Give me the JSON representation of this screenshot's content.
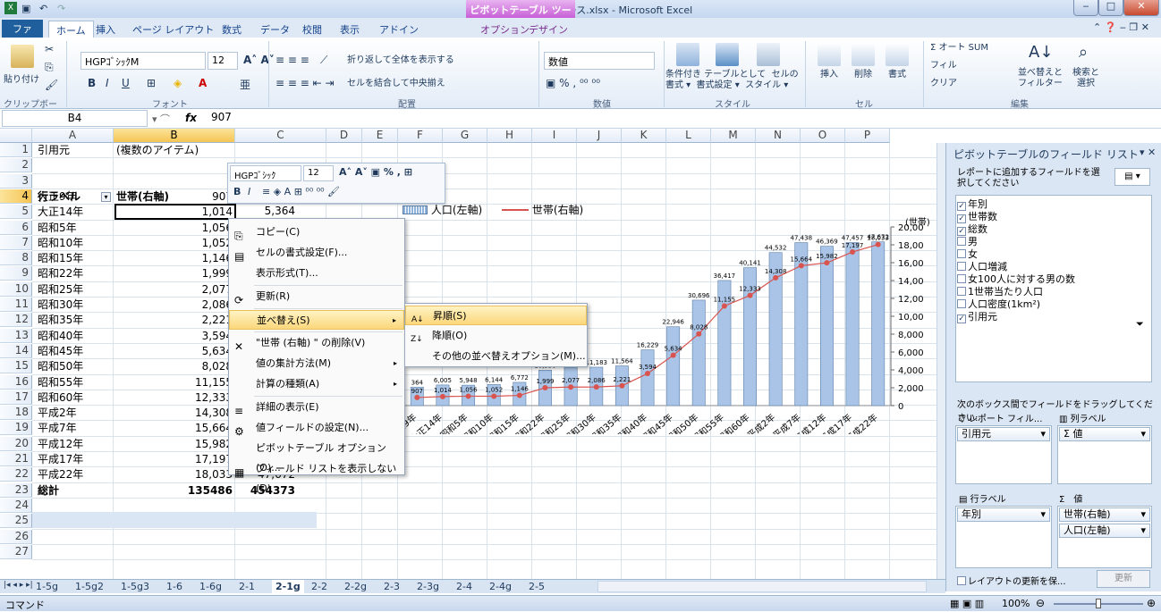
{
  "app": {
    "title": "統計さむかわデータベース.xlsx - Microsoft Excel",
    "context_tab_group": "ピボットテーブル ツール"
  },
  "ribbon_tabs": [
    "ファイル",
    "ホーム",
    "挿入",
    "ページ レイアウト",
    "数式",
    "データ",
    "校閲",
    "表示",
    "アドイン",
    "オプション",
    "デザイン"
  ],
  "ribbon": {
    "clipboard": {
      "paste": "貼り付け",
      "label": "クリップボード"
    },
    "font": {
      "name": "HGPｺﾞｼｯｸM",
      "size": "12",
      "label": "フォント"
    },
    "alignment": {
      "wrap": "折り返して全体を表示する",
      "merge": "セルを結合して中央揃え",
      "label": "配置"
    },
    "number": {
      "format": "数値",
      "label": "数値"
    },
    "styles": {
      "cond": "条件付き\n書式",
      "table": "テーブルとして\n書式設定",
      "cell": "セルの\nスタイル",
      "label": "スタイル"
    },
    "cells": {
      "insert": "挿入",
      "delete": "削除",
      "format": "書式",
      "label": "セル"
    },
    "edit": {
      "autosum": "Σ オート SUM",
      "fill": "フィル",
      "clear": "クリア",
      "sort": "並べ替えと\nフィルター",
      "find": "検索と\n選択",
      "label": "編集"
    }
  },
  "formula_bar": {
    "name_box": "B4",
    "fx": "fx",
    "value": "907"
  },
  "columns": [
    "A",
    "B",
    "C",
    "D",
    "E",
    "F",
    "G",
    "H",
    "I",
    "J",
    "K",
    "L",
    "M",
    "N",
    "O",
    "P"
  ],
  "rows": [
    "1",
    "2",
    "3",
    "4",
    "5",
    "6",
    "7",
    "8",
    "9",
    "10",
    "11",
    "12",
    "13",
    "14",
    "15",
    "16",
    "17",
    "18",
    "19",
    "20",
    "21",
    "22",
    "23",
    "24",
    "25",
    "26",
    "27"
  ],
  "pivot": {
    "r1_a": "引用元",
    "r1_b": "(複数のアイテム)",
    "r3_a": "行ラベル",
    "r3_b": "世帯(右軸)",
    "c4_partial": "5,364",
    "c19_partial": "46,369",
    "c20_partial": "46,369",
    "rows": [
      {
        "label": "大正9年",
        "households": "907",
        "pop": ""
      },
      {
        "label": "大正14年",
        "households": "1,014",
        "pop": ""
      },
      {
        "label": "昭和5年",
        "households": "1,056",
        "pop": ""
      },
      {
        "label": "昭和10年",
        "households": "1,052",
        "pop": ""
      },
      {
        "label": "昭和15年",
        "households": "1,146",
        "pop": ""
      },
      {
        "label": "昭和22年",
        "households": "1,999",
        "pop": ""
      },
      {
        "label": "昭和25年",
        "households": "2,077",
        "pop": ""
      },
      {
        "label": "昭和30年",
        "households": "2,086",
        "pop": ""
      },
      {
        "label": "昭和35年",
        "households": "2,221",
        "pop": ""
      },
      {
        "label": "昭和40年",
        "households": "3,594",
        "pop": ""
      },
      {
        "label": "昭和45年",
        "households": "5,634",
        "pop": ""
      },
      {
        "label": "昭和50年",
        "households": "8,028",
        "pop": ""
      },
      {
        "label": "昭和55年",
        "households": "11,155",
        "pop": ""
      },
      {
        "label": "昭和60年",
        "households": "12,333",
        "pop": ""
      },
      {
        "label": "平成2年",
        "households": "14,308",
        "pop": ""
      },
      {
        "label": "平成7年",
        "households": "15,664",
        "pop": ""
      },
      {
        "label": "平成12年",
        "households": "15,982",
        "pop": ""
      },
      {
        "label": "平成17年",
        "households": "17,197",
        "pop": "47,457"
      },
      {
        "label": "平成22年",
        "households": "18,033",
        "pop": "47,672"
      }
    ],
    "total": {
      "label": "総計",
      "households": "135486",
      "pop": "454373"
    }
  },
  "mini_toolbar": {
    "font": "HGPｺﾞｼｯｸ",
    "size": "12"
  },
  "context_menu": [
    {
      "label": "コピー(C)",
      "icon": "copy-icon"
    },
    {
      "label": "セルの書式設定(F)...",
      "icon": "format-cells-icon"
    },
    {
      "label": "表示形式(T)...",
      "icon": ""
    },
    {
      "label": "更新(R)",
      "icon": "refresh-icon"
    },
    {
      "label": "並べ替え(S)",
      "icon": "",
      "submenu": true,
      "highlighted": true
    },
    {
      "label": "\"世帯 (右軸) \" の削除(V)",
      "icon": "delete-x-icon"
    },
    {
      "label": "値の集計方法(M)",
      "icon": "",
      "submenu": true
    },
    {
      "label": "計算の種類(A)",
      "icon": "",
      "submenu": true
    },
    {
      "label": "詳細の表示(E)",
      "icon": "details-icon"
    },
    {
      "label": "値フィールドの設定(N)...",
      "icon": "field-settings-icon"
    },
    {
      "label": "ピボットテーブル オプション(O)...",
      "icon": ""
    },
    {
      "label": "フィールド リストを表示しない(D)",
      "icon": "field-list-icon"
    }
  ],
  "submenu": [
    {
      "label": "昇順(S)",
      "icon": "sort-asc-icon"
    },
    {
      "label": "降順(O)",
      "icon": "sort-desc-icon"
    },
    {
      "label": "その他の並べ替えオプション(M)...",
      "icon": ""
    }
  ],
  "chart_data": {
    "type": "bar",
    "categories": [
      "大正9年",
      "大正14年",
      "昭和5年",
      "昭和10年",
      "昭和15年",
      "昭和22年",
      "昭和25年",
      "昭和30年",
      "昭和35年",
      "昭和40年",
      "昭和45年",
      "昭和50年",
      "昭和55年",
      "昭和60年",
      "平成2年",
      "平成7年",
      "平成12年",
      "平成17年",
      "平成22年"
    ],
    "series": [
      {
        "name": "人口(左軸)",
        "kind": "bar",
        "values": [
          5364,
          6005,
          5948,
          6144,
          6772,
          10330,
          11166,
          11183,
          11564,
          16229,
          22946,
          30696,
          36417,
          40141,
          44532,
          47438,
          46369,
          47457,
          47672
        ],
        "color": "#8fb2dc"
      },
      {
        "name": "世帯(右軸)",
        "kind": "line",
        "values": [
          907,
          1014,
          1056,
          1052,
          1146,
          1999,
          2077,
          2086,
          2221,
          3594,
          5634,
          8028,
          11155,
          12333,
          14308,
          15664,
          15982,
          17197,
          18033
        ],
        "color": "#d9534f"
      }
    ],
    "bar_labels": [
      "364",
      "6,005",
      "5,948",
      "6,144",
      "6,772",
      "10,330",
      "11,166",
      "11,183",
      "11,564",
      "16,229",
      "22,946",
      "30,696",
      "36,417",
      "40,141",
      "44,532",
      "47,438",
      "46,369",
      "47,457",
      "47,672"
    ],
    "line_labels": [
      "907",
      "1,014",
      "1,056",
      "1,052",
      "1,146",
      "1,999",
      "2,077",
      "2,086",
      "2,221",
      "3,594",
      "5,634",
      "8,028",
      "11,155",
      "12,333",
      "14,308",
      "15,664",
      "15,982",
      "17,197",
      "18,033"
    ],
    "y_right_unit": "(世帯)",
    "y_right_ticks": [
      "0",
      "2,000",
      "4,000",
      "6,000",
      "8,000",
      "10,000",
      "12,000",
      "14,000",
      "16,000",
      "18,000",
      "20,000"
    ],
    "y2lim": [
      0,
      20000
    ],
    "legend": "top"
  },
  "field_list": {
    "title": "ピボットテーブルのフィールド リスト",
    "instruction": "レポートに追加するフィールドを選択してください",
    "fields": [
      {
        "label": "年別",
        "checked": true
      },
      {
        "label": "世帯数",
        "checked": true
      },
      {
        "label": "総数",
        "checked": true
      },
      {
        "label": "男",
        "checked": false
      },
      {
        "label": "女",
        "checked": false
      },
      {
        "label": "人口増減",
        "checked": false
      },
      {
        "label": "女100人に対する男の数",
        "checked": false
      },
      {
        "label": "1世帯当たり人口",
        "checked": false
      },
      {
        "label": "人口密度(1km²)",
        "checked": false
      },
      {
        "label": "引用元",
        "checked": true
      }
    ],
    "drag_hint": "次のボックス間でフィールドをドラッグしてください:",
    "report_filter": "レポート フィル...",
    "col_labels": "列ラベル",
    "filter_chip": "引用元",
    "col_chip": "Σ 値",
    "row_labels": "行ラベル",
    "values": "Σ　値",
    "row_chip": "年別",
    "val_chip1": "世帯(右軸)",
    "val_chip2": "人口(左軸)",
    "defer": "レイアウトの更新を保...",
    "update": "更新"
  },
  "sheet_tabs": [
    "1-5g",
    "1-5g2",
    "1-5g3",
    "1-6",
    "1-6g",
    "2-1",
    "2-1g",
    "2-2",
    "2-2g",
    "2-3",
    "2-3g",
    "2-4",
    "2-4g",
    "2-5"
  ],
  "active_sheet": "2-1g",
  "status": {
    "mode": "コマンド",
    "zoom": "100%"
  }
}
